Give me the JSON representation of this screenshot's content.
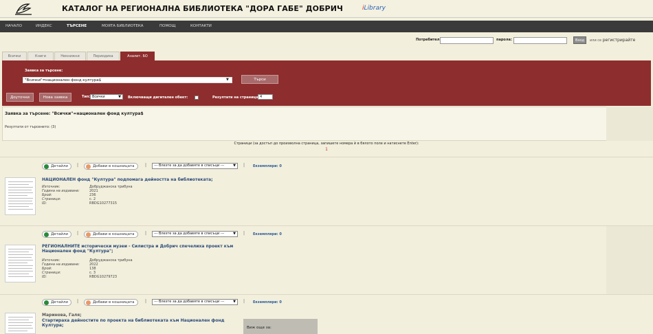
{
  "header": {
    "title": "КАТАЛОГ НА РЕГИОНАЛНА БИБЛИОТЕКА \"ДОРА ГАБЕ\" ДОБРИЧ",
    "brand_i": "i",
    "brand_text": "Library"
  },
  "nav": [
    "НАЧАЛО",
    "ИНДЕКС",
    "ТЪРСЕНЕ",
    "МОЯТА БИБЛИОТЕКА",
    "ПОМОЩ",
    "КОНТАКТИ"
  ],
  "login": {
    "user_label": "Потребител:",
    "pass_label": "парола:",
    "button": "Вход",
    "or_text": "или се",
    "register": "регистрирайте"
  },
  "tabs": [
    "Всички",
    "Книги",
    "Некнижни",
    "Периодика",
    "Аналит. БО"
  ],
  "search": {
    "query_label": "Заявка за търсене:",
    "query_value": "\"Всички\"=национален фонд култура$",
    "search_button": "Търси",
    "refine_button": "Доуточни",
    "new_button": "Нова заявка",
    "type_label": "Тип:",
    "type_value": "Всички",
    "digital_label": "Включващи дигитален обект:",
    "per_page_label": "Резултати на страница:",
    "per_page_value": "4"
  },
  "query_box": {
    "title": "Заявка за търсене: \"Всички\"=национален фонд култура$",
    "results": "Резултати от търсенето: (3)"
  },
  "pagination": {
    "hint": "Страници (за достъп до произволна страница, запишете номера ѝ в бялото поле и натиснете Enter):",
    "current": "1"
  },
  "actions": {
    "details": "Детайли",
    "basket": "Добави в кошницата",
    "list_select": "--- Влезте за да добавяте в списъци ---",
    "sep": "|"
  },
  "records": [
    {
      "title": "НАЦИОНАЛЕН фонд \"Култура\" подпомага дейността на библиотеката;",
      "author": "",
      "copies": "Екземпляри: 0",
      "meta_keys": [
        "Източник:",
        "Година на издаване:",
        "Брой:",
        "Страници:",
        "ID:"
      ],
      "meta_vals": [
        "Добруджанска трибуна",
        "2021",
        "236",
        "с. 2",
        "RBDG10277315"
      ]
    },
    {
      "title": "РЕГИОНАЛНИТЕ исторически музеи - Силистра и Добрич спечелиха проект към Национален фонд \"Култура\";",
      "author": "",
      "copies": "Екземпляри: 0",
      "meta_keys": [
        "Източник:",
        "Година на издаване:",
        "Брой:",
        "Страници:",
        "ID:"
      ],
      "meta_vals": [
        "Добруджанска трибуна",
        "2022",
        "138",
        "с. 3",
        "RBDG10279723"
      ]
    },
    {
      "title": "Стартираха дейностите по проекта на библиотеката към Национален фонд Култура;",
      "author": "Маринова, Галя;",
      "copies": "Екземпляри: 0",
      "meta_keys": [],
      "meta_vals": []
    }
  ],
  "more_panel": {
    "label": "Виж още за:"
  },
  "colors": {
    "panel": "#8e2d2d",
    "nav": "#3a3a3a",
    "bg": "#f2efdc"
  }
}
